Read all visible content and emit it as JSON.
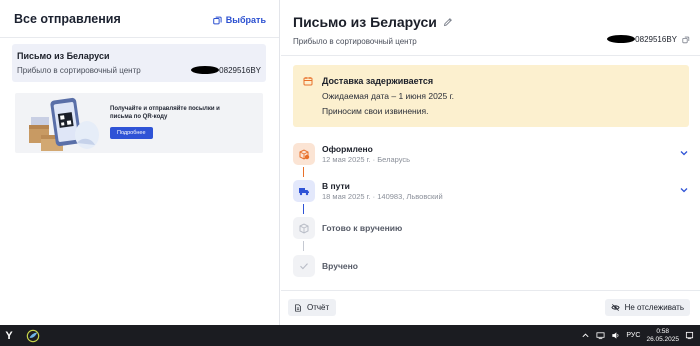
{
  "sidebar": {
    "title": "Все отправления",
    "select_label": "Выбрать",
    "item": {
      "title": "Письмо из Беларуси",
      "status": "Прибыло в сортировочный центр",
      "track_suffix": "0829516BY"
    },
    "promo": {
      "text": "Получайте и отправляйте посылки и письма по QR-коду",
      "button": "Подробнее"
    }
  },
  "detail": {
    "title": "Письмо из Беларуси",
    "status": "Прибыло в сортировочный центр",
    "track_suffix": "0829516BY",
    "alert": {
      "title": "Доставка задерживается",
      "line1": "Ожидаемая дата – 1 июня 2025 г.",
      "line2": "Приносим свои извинения."
    },
    "steps": [
      {
        "title": "Оформлено",
        "date": "12 мая 2025 г. · Беларусь"
      },
      {
        "title": "В пути",
        "date": "18 мая 2025 г. · 140983, Львовский"
      },
      {
        "title": "Готово к вручению",
        "date": ""
      },
      {
        "title": "Вручено",
        "date": ""
      }
    ],
    "report_button": "Отчёт",
    "untrack_button": "Не отслеживать"
  },
  "taskbar": {
    "start_label": "Y",
    "lang": "РУС",
    "time": "0:58",
    "date": "26.05.2025"
  },
  "colors": {
    "accent": "#2f53d6",
    "alert_bg": "#fcf0cf",
    "step_done": "#e8702a",
    "step_transit": "#2f53d6",
    "step_pending": "#b8bcc6"
  }
}
